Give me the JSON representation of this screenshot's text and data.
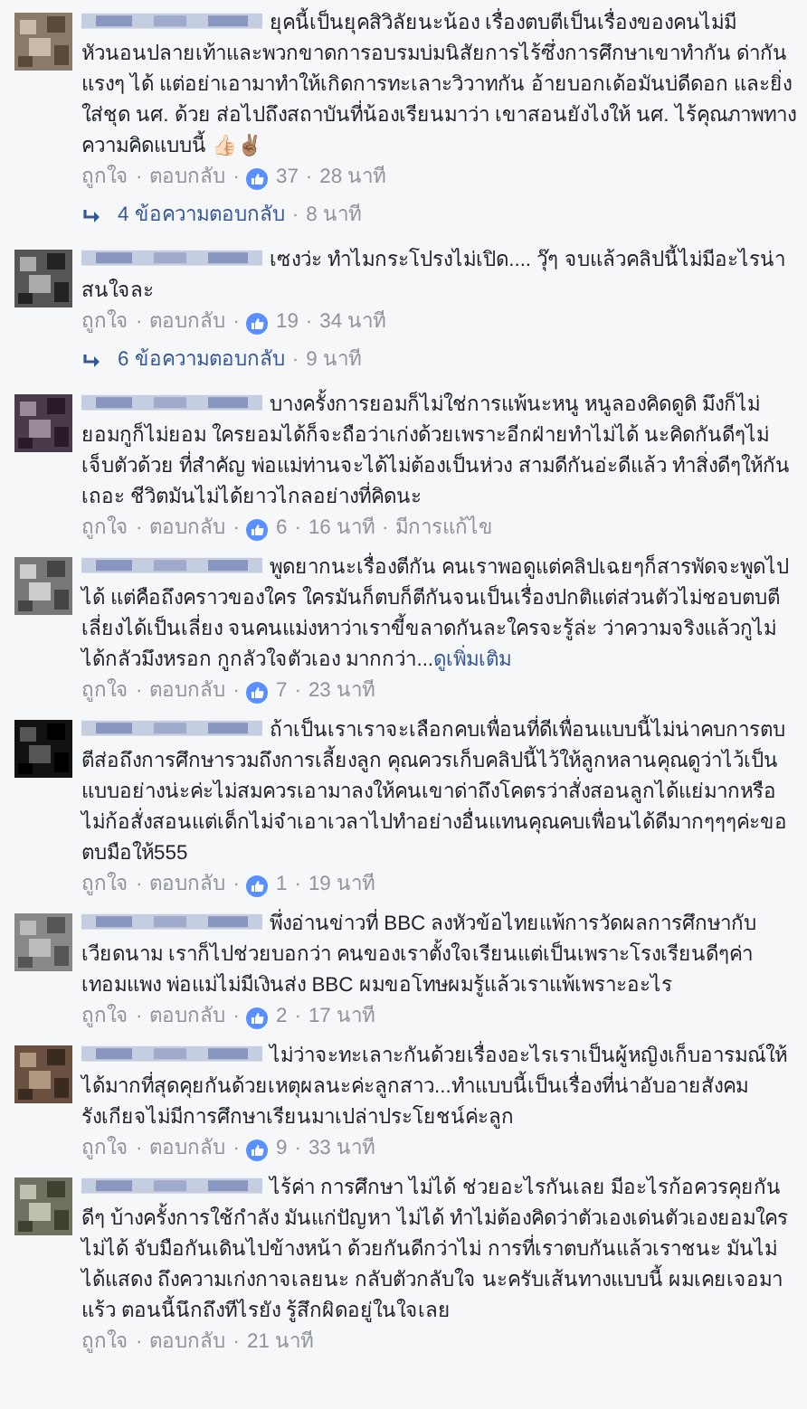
{
  "separator": "·",
  "comments": [
    {
      "text": "ยุคนี้เป็นยุคสิวิลัยนะน้อง เรื่องตบตีเป็นเรื่องของคนไม่มีหัวนอนปลายเท้าและพวกขาดการอบรมบ่มนิสัยการไร้ซึ่งการศึกษาเขาทำกัน ด่ากันแรงๆ ได้ แต่อย่าเอามาทำให้เกิดการทะเลาะวิวาทกัน อ้ายบอกเด้อมันบ่ดีดอก และยิ่งใส่ชุด นศ. ด้วย ส่อไปถึงสถาบันที่น้องเรียนมาว่า เขาสอนยังไงให้ นศ. ไร้คุณภาพทางความคิดแบบนี้ 👍🏻✌🏽",
      "like": "ถูกใจ",
      "reply": "ตอบกลับ",
      "likes": "37",
      "time": "28 นาที",
      "replies": {
        "count": "4 ข้อความตอบกลับ",
        "time": "8 นาที"
      }
    },
    {
      "text": "เซงว่ะ ทำไมกระโปรงไม่เปิด.... วุ๊ๆ จบแล้วคลิปนี้ไม่มีอะไรน่าสนใจละ",
      "like": "ถูกใจ",
      "reply": "ตอบกลับ",
      "likes": "19",
      "time": "34 นาที",
      "replies": {
        "count": "6 ข้อความตอบกลับ",
        "time": "9 นาที"
      }
    },
    {
      "text": "บางครั้งการยอมก็ไม่ใช่การแพ้นะหนู หนูลองคิดดูดิ มึงก็ไม่ยอมกูก็ไม่ยอม ใครยอมได้ก็จะถือว่าเก่งด้วยเพราะอีกฝ่ายทำไม่ได้ นะคิดกันดีๆไม่เจ็บตัวด้วย ที่สำคัญ พ่อแม่ท่านจะได้ไม่ต้องเป็นห่วง สามดีกันอ่ะดีแล้ว ทำสิ่งดีๆให้กันเถอะ ชีวิตมันไม่ได้ยาวไกลอย่างที่คิดนะ",
      "like": "ถูกใจ",
      "reply": "ตอบกลับ",
      "likes": "6",
      "time": "16 นาที",
      "edited": "มีการแก้ไข"
    },
    {
      "text": "พูดยากนะเรื่องตีกัน คนเราพอดูแต่คลิปเฉยๆก็สารพัดจะพูดไปได้ แต่คือถึงคราวของใคร ใครมันก็ตบก็ตีกันจนเป็นเรื่องปกติแต่ส่วนตัวไม่ชอบตบตี เลี่ยงได้เป็นเลี่ยง จนคนแม่งหาว่าเราขี้ขลาดกันละใครจะรู้ล่ะ ว่าความจริงแล้วกูไม่ได้กลัวมึงหรอก กูกลัวใจตัวเอง มากกว่า...",
      "see_more": "ดูเพิ่มเติม",
      "like": "ถูกใจ",
      "reply": "ตอบกลับ",
      "likes": "7",
      "time": "23 นาที"
    },
    {
      "text": "ถ้าเป็นเราเราจะเลือกคบเพื่อนที่ดีเพื่อนแบบนี้ไม่น่าคบการตบตีส่อถึงการศึกษารวมถึงการเลี้ยงลูก คุณควรเก็บคลิปนี้ไว้ให้ลูกหลานคุณดูว่าไว้เป็นแบบอย่างน่ะค่ะไม่สมควรเอามาลงให้คนเขาด่าถึงโคตรว่าสั่งสอนลูกได้แย่มากหรือไม่ก้อสั่งสอนแต่เด็กไม่จำเอาเวลาไปทำอย่างอื่นแทนคุณคบเพื่อนได้ดีมากๆๆๆค่ะขอตบมือให้555",
      "like": "ถูกใจ",
      "reply": "ตอบกลับ",
      "likes": "1",
      "time": "19 นาที"
    },
    {
      "text": "พึ่งอ่านข่าวที่ BBC ลงหัวข้อไทยแพ้การวัดผลการศึกษากับเวียดนาม เราก็ไปช่วยบอกว่า คนของเราตั้งใจเรียนแต่เป็นเพราะโรงเรียนดีๆค่าเทอมแพง พ่อแม่ไม่มีเงินส่ง BBC ผมขอโทษผมรู้แล้วเราแพ้เพราะอะไร",
      "like": "ถูกใจ",
      "reply": "ตอบกลับ",
      "likes": "2",
      "time": "17 นาที"
    },
    {
      "text": "ไม่ว่าจะทะเลาะกันด้วยเรื่องอะไรเราเป็นผู้หญิงเก็บอารมณ์ให้ได้มากที่สุดคุยกันด้วยเหตุผลนะค่ะลูกสาว...ทำแบบนี้เป็นเรื่องที่น่าอับอายสังคมรังเกียจไม่มีการศึกษาเรียนมาเปล่าประโยชน์ค่ะลูก",
      "like": "ถูกใจ",
      "reply": "ตอบกลับ",
      "likes": "9",
      "time": "33 นาที"
    },
    {
      "text": "ไร้ค่า การศึกษา ไม่ได้ ช่วยอะไรกันเลย มีอะไรก้อควรคุยกันดีๆ บ้างครั้งการใช้กำลัง มันแก่ปัญหา ไม่ได้ ทำไม่ต้องคิดว่าตัวเองเด่นตัวเองยอมใครไม่ได้ จับมือกันเดินไปข้างหน้า ด้วยกันดีกว่าไม่ การที่เราตบกันแล้วเราชนะ มันไม่ได้แสดง ถึงความเก่งกาจเลยนะ กลับตัวกลับใจ นะครับเส้นทางแบบนี้ ผมเคยเจอมาแร้ว ตอนนี้นึกถึงทีไรยัง รู้สึกผิดอยู่ในใจเลย",
      "like": "ถูกใจ",
      "reply": "ตอบกลับ",
      "time": "21 นาที"
    }
  ]
}
